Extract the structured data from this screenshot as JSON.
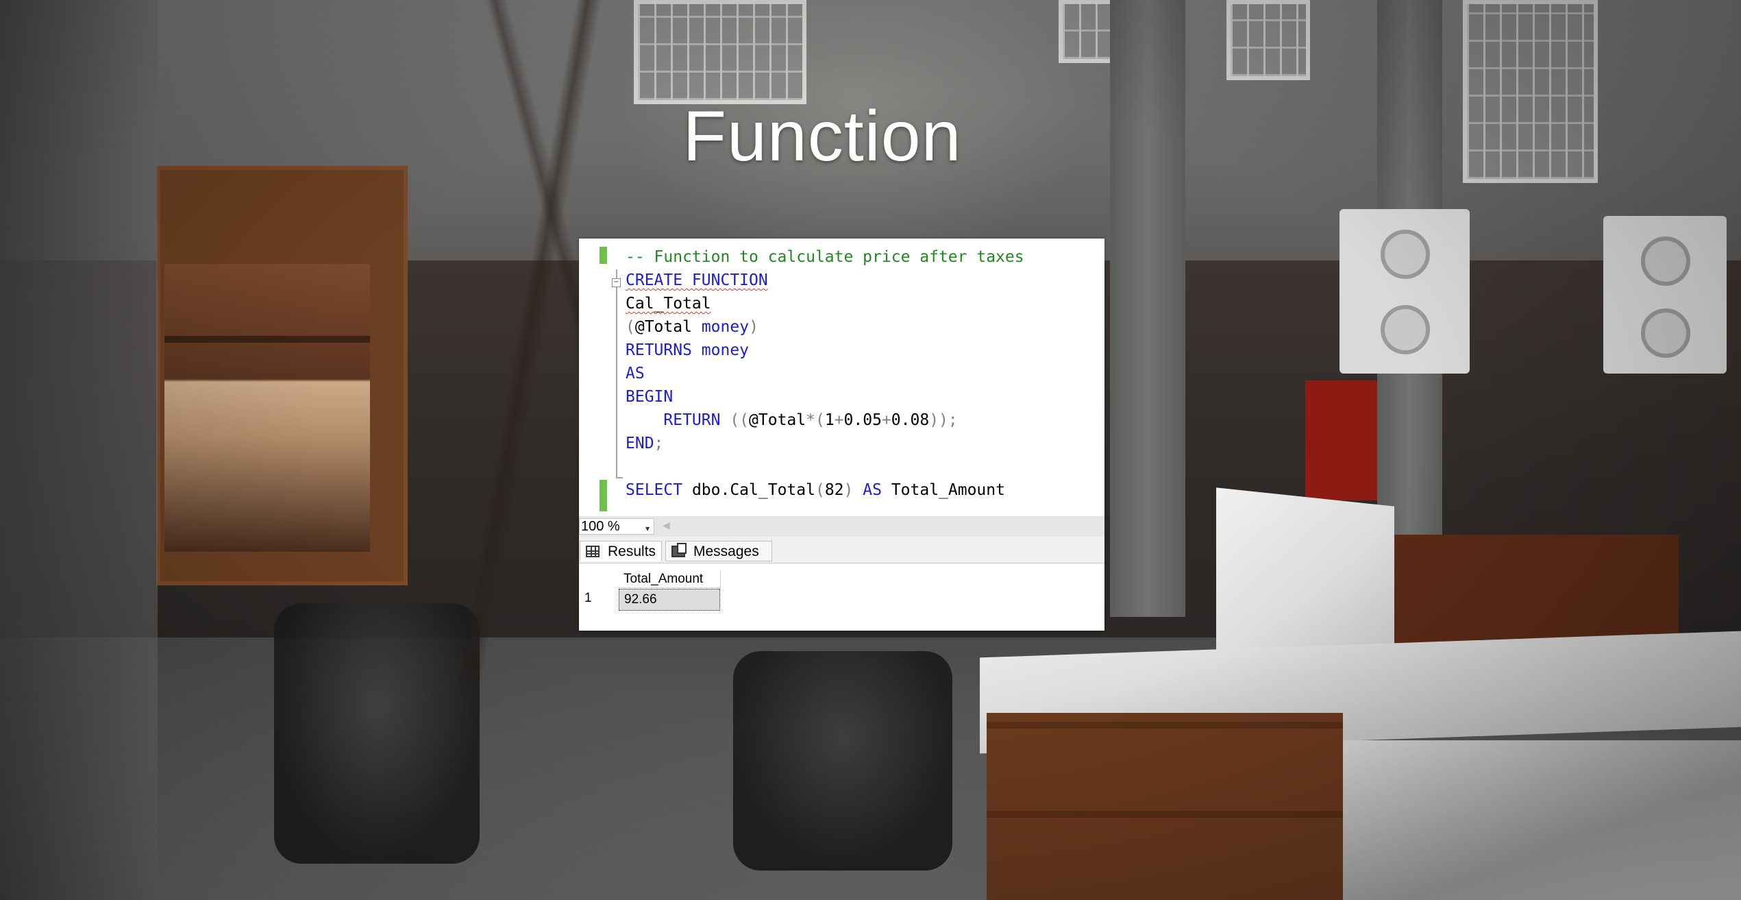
{
  "slide": {
    "title": "Function"
  },
  "editor": {
    "lines": {
      "l1": "-- Function to calculate price after taxes",
      "l2": "CREATE FUNCTION",
      "l3": "Cal_Total",
      "l4_open": "(",
      "l4_param": "@Total",
      "l4_type": "money",
      "l4_close": ")",
      "l5_kw": "RETURNS",
      "l5_type": "money",
      "l6": "AS",
      "l7": "BEGIN",
      "l8_kw": "RETURN",
      "l8_open": " ((",
      "l8_var": "@Total",
      "l8_op1": "*(",
      "l8_n1": "1",
      "l8_plus1": "+",
      "l8_n2": "0.05",
      "l8_plus2": "+",
      "l8_n3": "0.08",
      "l8_close": "));",
      "l9_kw": "END",
      "l9_semi": ";",
      "l10_kw1": "SELECT",
      "l10_fn": " dbo.Cal_Total",
      "l10_open": "(",
      "l10_arg": "82",
      "l10_close": ")",
      "l10_kw2": "AS",
      "l10_alias": " Total_Amount"
    },
    "fold_symbol": "−"
  },
  "statusbar": {
    "zoom": "100 %",
    "zoom_caret": "▾",
    "scroll_left": "◀"
  },
  "tabs": {
    "results": "Results",
    "messages": "Messages"
  },
  "results": {
    "columns": [
      "Total_Amount"
    ],
    "rows": [
      {
        "num": "1",
        "values": [
          "92.66"
        ]
      }
    ]
  },
  "colors": {
    "keyword": "#1c1cd6",
    "comment": "#1e8a1e",
    "operator": "#808080",
    "change_bar": "#6cc24a"
  }
}
